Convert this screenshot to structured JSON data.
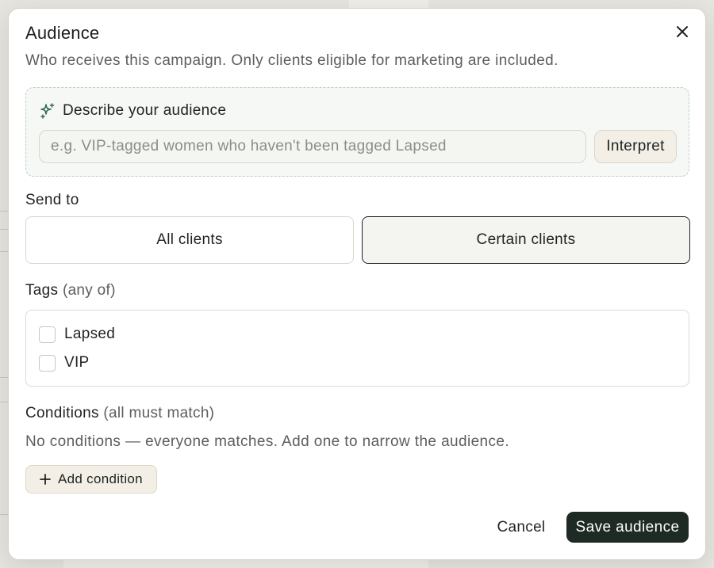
{
  "modal": {
    "title": "Audience",
    "subtitle": "Who receives this campaign. Only clients eligible for marketing are included."
  },
  "ai": {
    "label": "Describe your audience",
    "placeholder": "e.g. VIP-tagged women who haven't been tagged Lapsed",
    "interpret_label": "Interpret"
  },
  "send_to": {
    "label": "Send to",
    "options": [
      "All clients",
      "Certain clients"
    ],
    "selected": "Certain clients"
  },
  "tags": {
    "label": "Tags",
    "qualifier": "(any of)",
    "items": [
      {
        "label": "Lapsed",
        "checked": false
      },
      {
        "label": "VIP",
        "checked": false
      }
    ]
  },
  "conditions": {
    "label": "Conditions",
    "qualifier": "(all must match)",
    "empty_note": "No conditions — everyone matches. Add one to narrow the audience.",
    "add_label": "Add condition"
  },
  "footer": {
    "cancel_label": "Cancel",
    "save_label": "Save audience"
  },
  "icons": {
    "close": "close-icon",
    "sparkle": "sparkle-icon",
    "plus": "plus-icon"
  },
  "colors": {
    "primary": "#1e2a24",
    "ai_border": "#bcd0c5",
    "ai_bg": "#f5f8f4",
    "secondary_btn_bg": "#f4efe6"
  }
}
